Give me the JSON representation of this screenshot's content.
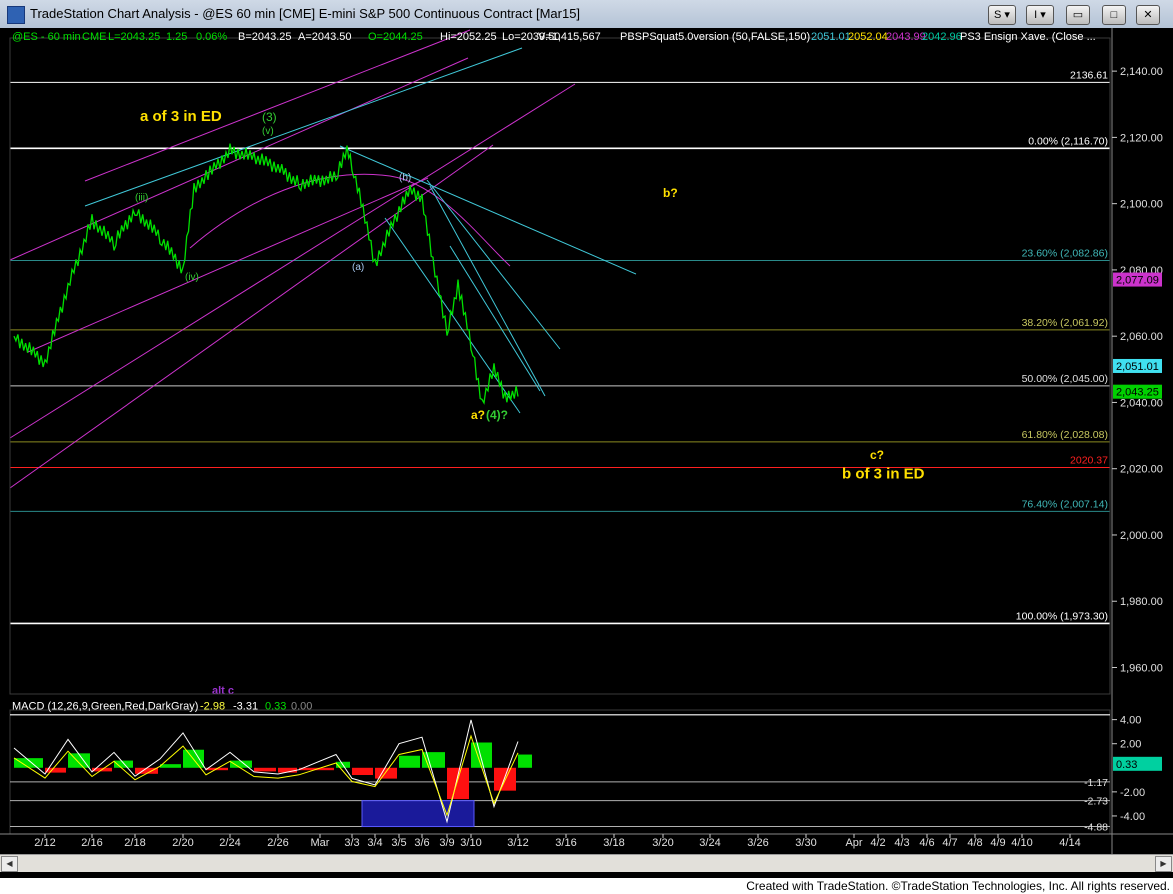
{
  "window": {
    "title": "TradeStation Chart Analysis - @ES 60 min [CME] E-mini S&P 500 Continuous Contract [Mar15]",
    "btn_s": "S ▾",
    "btn_i": "I ▾",
    "btn_min": "▭",
    "btn_max": "□",
    "btn_close": "✕"
  },
  "footer": {
    "text": "Created with TradeStation. ©TradeStation Technologies, Inc. All rights reserved."
  },
  "header": {
    "symbol": "@ES - 60 min",
    "exchange": "CME",
    "last": "L=2043.25",
    "change": "1.25",
    "pct": "0.06%",
    "bid": "B=2043.25",
    "ask": "A=2043.50",
    "open": "O=2044.25",
    "high": "Hi=2052.25",
    "low": "Lo=2039.50",
    "volume": "V=1,415,567",
    "indicator": "PBSPSquat5.0version (50,FALSE,150)",
    "ind_v1": "2051.01",
    "ind_v2": "2052.04",
    "ind_v3": "2043.99",
    "ind_v4": "2042.96",
    "ind2": "PS3 Ensign Xave. (Close ..."
  },
  "macd_header": {
    "label": "MACD (12,26,9,Green,Red,DarkGray)",
    "v1": "-2.98",
    "v2": "-3.31",
    "v3": "0.33",
    "v4": "0.00"
  },
  "colors": {
    "price": "#00e000",
    "fib": "#ffffff",
    "magenta": "#cc33cc",
    "cyan": "#40c8d8",
    "label_yellow": "#ffe000",
    "label_green": "#33cc33",
    "red_line": "#ff2020",
    "macd_fast": "#ffffff",
    "macd_slow": "#ffff00"
  },
  "chart_data": [
    {
      "type": "line",
      "title": "@ES 60 min E-mini S&P 500 Continuous Contract [Mar15]",
      "xlabel": "",
      "ylabel": "",
      "x_ticks": [
        "2/12",
        "2/16",
        "2/18",
        "2/20",
        "2/24",
        "2/26",
        "Mar",
        "3/3",
        "3/4",
        "3/5",
        "3/6",
        "3/9",
        "3/10",
        "3/12",
        "3/16",
        "3/18",
        "3/20",
        "3/24",
        "3/26",
        "3/30",
        "Apr",
        "4/2",
        "4/3",
        "4/6",
        "4/7",
        "4/8",
        "4/9",
        "4/10",
        "4/14"
      ],
      "y_ticks": [
        1960,
        1980,
        2000,
        2020,
        2040,
        2060,
        2080,
        2100,
        2120,
        2140
      ],
      "y_tick_labels": [
        "1,960.00",
        "1,980.00",
        "2,000.00",
        "2,020.00",
        "2,040.00",
        "2,060.00",
        "2,080.00",
        "2,100.00",
        "2,120.00",
        "2,140.00"
      ],
      "ylim": [
        1952,
        2150
      ],
      "grid": false,
      "price_series": {
        "x": [
          "2/11",
          "2/12",
          "2/13",
          "2/16",
          "2/17",
          "2/18",
          "2/19",
          "2/20",
          "2/20",
          "2/23",
          "2/24",
          "2/25",
          "2/26",
          "2/27",
          "3/2",
          "3/2",
          "3/3",
          "3/3",
          "3/4",
          "3/5",
          "3/5",
          "3/6",
          "3/6",
          "3/9",
          "3/9",
          "3/10",
          "3/10",
          "3/11",
          "3/11",
          "3/12"
        ],
        "y": [
          2060,
          2052,
          2075,
          2095,
          2088,
          2098,
          2090,
          2080,
          2105,
          2108,
          2116,
          2114,
          2111,
          2106,
          2108,
          2116,
          2112,
          2098,
          2082,
          2098,
          2104,
          2102,
          2082,
          2062,
          2075,
          2058,
          2040,
          2050,
          2042,
          2043
        ]
      },
      "fib_levels": [
        {
          "label": "0.00% (2,116.70)",
          "value": 2116.7
        },
        {
          "label": "23.60% (2,082.86)",
          "value": 2082.86
        },
        {
          "label": "38.20% (2,061.92)",
          "value": 2061.92
        },
        {
          "label": "50.00% (2,045.00)",
          "value": 2045.0
        },
        {
          "label": "61.80% (2,028.08)",
          "value": 2028.08
        },
        {
          "label": "76.40% (2,007.14)",
          "value": 2007.14
        },
        {
          "label": "100.00% (1,973.30)",
          "value": 1973.3
        }
      ],
      "level_labels": [
        {
          "label": "2136.61",
          "value": 2136.61
        },
        {
          "label": "2020.37",
          "value": 2020.37
        }
      ],
      "price_badges": [
        {
          "label": "2,077.09",
          "value": 2077.09,
          "color": "#cc33cc"
        },
        {
          "label": "2,051.01",
          "value": 2051.01,
          "color": "#40e0f0"
        },
        {
          "label": "2,043.25",
          "value": 2043.25,
          "color": "#00d000"
        }
      ],
      "annotations": [
        {
          "text": "a of 3 in ED",
          "x": "2/19",
          "y": 2125
        },
        {
          "text": "(3)",
          "x": "2/25",
          "y": 2125
        },
        {
          "text": "(v)",
          "x": "2/25",
          "y": 2121
        },
        {
          "text": "(iii)",
          "x": "2/18",
          "y": 2101
        },
        {
          "text": "(iv)",
          "x": "2/20",
          "y": 2077
        },
        {
          "text": "(b)",
          "x": "3/5",
          "y": 2107
        },
        {
          "text": "(a)",
          "x": "3/3",
          "y": 2080
        },
        {
          "text": "b?",
          "x": "3/20",
          "y": 2102
        },
        {
          "text": "a?",
          "x": "3/10",
          "y": 2035
        },
        {
          "text": "(4)?",
          "x": "3/11",
          "y": 2035
        },
        {
          "text": "c?",
          "x": "4/2",
          "y": 2023
        },
        {
          "text": "b of 3 in ED",
          "x": "4/2",
          "y": 2017
        },
        {
          "text": "alt c",
          "x": "2/24",
          "y": 1952
        }
      ]
    },
    {
      "type": "bar",
      "title": "MACD (12,26,9,Green,Red,DarkGray)",
      "y_ticks": [
        4,
        2,
        -2,
        -4
      ],
      "y_tick_labels": [
        "4.00",
        "2.00",
        "-2.00",
        "-4.00"
      ],
      "ylim": [
        -5.5,
        4.8
      ],
      "ref_labels": [
        {
          "label": "-1.17",
          "value": -1.17
        },
        {
          "label": "-2.73",
          "value": -2.73
        },
        {
          "label": "-4.88",
          "value": -4.88
        },
        {
          "label": "0.33",
          "value": 0.33
        }
      ],
      "histogram": {
        "x": [
          "2/11",
          "2/12",
          "2/13",
          "2/16",
          "2/17",
          "2/18",
          "2/19",
          "2/20",
          "2/23",
          "2/24",
          "2/25",
          "2/26",
          "2/27",
          "3/2",
          "3/3",
          "3/4",
          "3/5",
          "3/6",
          "3/9",
          "3/10",
          "3/11",
          "3/12"
        ],
        "values": [
          0.8,
          -0.4,
          1.2,
          -0.3,
          0.6,
          -0.5,
          0.3,
          1.5,
          -0.2,
          0.6,
          -0.3,
          -0.4,
          -0.2,
          0.5,
          -0.6,
          -0.9,
          1.0,
          1.3,
          -2.6,
          2.1,
          -1.9,
          1.1
        ]
      }
    }
  ]
}
